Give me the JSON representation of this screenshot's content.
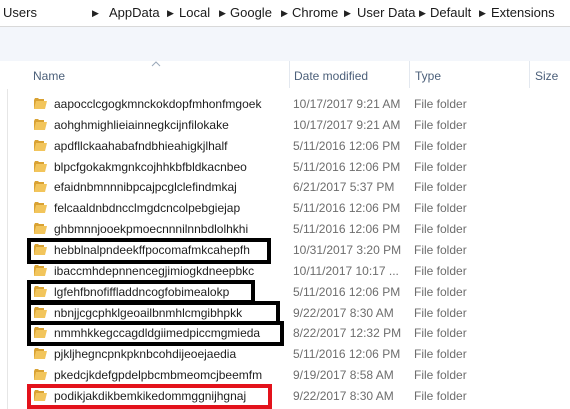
{
  "address_bar": {
    "crumbs": [
      "Users",
      "AppData",
      "Local",
      "Google",
      "Chrome",
      "User Data",
      "Default",
      "Extensions"
    ],
    "separator_icon": "chevron-right-icon"
  },
  "columns": {
    "name": "Name",
    "date_modified": "Date modified",
    "type": "Type",
    "size": "Size"
  },
  "rows": [
    {
      "name": "aapocclcgogkmnckokdopfmhonfmgoek",
      "date": "10/17/2017 9:21 AM",
      "type": "File folder"
    },
    {
      "name": "aohghmighlieiainnegkcijnfilokake",
      "date": "10/17/2017 9:21 AM",
      "type": "File folder"
    },
    {
      "name": "apdfllckaahabafndbhieahigkjlhalf",
      "date": "5/11/2016 12:06 PM",
      "type": "File folder"
    },
    {
      "name": "blpcfgokakmgnkcojhhkbfbldkacnbeo",
      "date": "5/11/2016 12:06 PM",
      "type": "File folder"
    },
    {
      "name": "efaidnbmnnnibpcajpcglclefindmkaj",
      "date": "6/21/2017 5:37 PM",
      "type": "File folder"
    },
    {
      "name": "felcaaldnbdncclmgdcncolpebgiejap",
      "date": "5/11/2016 12:06 PM",
      "type": "File folder"
    },
    {
      "name": "ghbmnnjooekpmoecnnnilnnbdlolhkhi",
      "date": "5/11/2016 12:06 PM",
      "type": "File folder"
    },
    {
      "name": "hebblnalpndeekffpocomafmkcahepfh",
      "date": "10/31/2017 3:20 PM",
      "type": "File folder"
    },
    {
      "name": "ibaccmhdepnnencegjimiogkdneepbkc",
      "date": "10/11/2017 10:17 ...",
      "type": "File folder"
    },
    {
      "name": "lgfehfbnofiffladdncogfobimealokp",
      "date": "5/11/2016 12:06 PM",
      "type": "File folder"
    },
    {
      "name": "nbnjjcgcphklgeoailbnmhlcmgibhpkk",
      "date": "9/22/2017 8:30 AM",
      "type": "File folder"
    },
    {
      "name": "nmmhkkegccagdldgiimedpiccmgmieda",
      "date": "8/22/2017 12:32 PM",
      "type": "File folder"
    },
    {
      "name": "pjkljhegncpnkpknbcohdijeoejaedia",
      "date": "5/11/2016 12:06 PM",
      "type": "File folder"
    },
    {
      "name": "pkedcjkdefgpdelpbcmbmeomcjbeemfm",
      "date": "9/19/2017 8:58 AM",
      "type": "File folder"
    },
    {
      "name": "podikjakdikbemkikedommggnijhgnaj",
      "date": "9/22/2017 8:30 AM",
      "type": "File folder"
    }
  ],
  "colors": {
    "highlight_black": "#000000",
    "highlight_red": "#e3121b",
    "folder_yellow": "#e8b84a"
  }
}
